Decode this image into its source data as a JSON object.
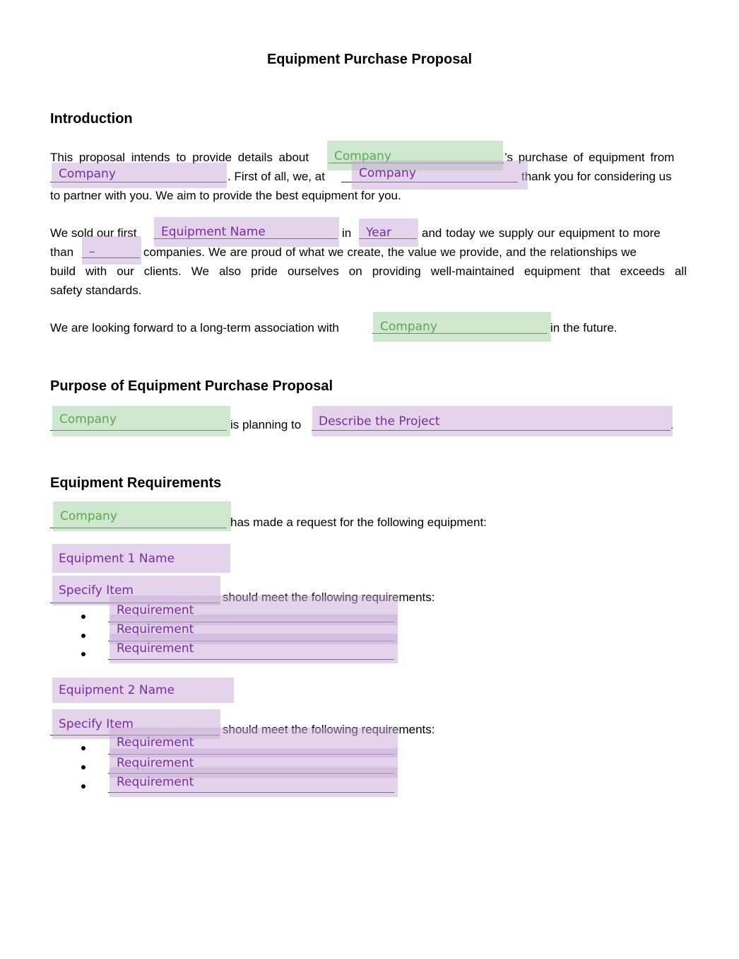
{
  "document": {
    "title": "Equipment Purchase Proposal",
    "sections": {
      "introduction": {
        "heading": "Introduction",
        "p1": {
          "line1_a": "This proposal intends to provide details about",
          "line1_b": "’s purchase of equipment from",
          "line2_a": ". First of all, we, at",
          "line2_b": "thank you for considering us",
          "line3": "to partner with you. We aim to provide the best equipment for you."
        },
        "p2": {
          "line1_a": "We sold our first",
          "line1_b": "in",
          "line1_c": "and today we supply our equipment to more",
          "line2_a": "than",
          "line2_b": "companies. We are proud of what we create, the value we provide, and the relationships we",
          "line3": "build with our clients. We also pride ourselves on providing well-maintained equipment that exceeds all",
          "line4": "safety standards."
        },
        "p3": {
          "a": "We are looking forward to a long-term association with",
          "b": "in the future."
        }
      },
      "purpose": {
        "heading": "Purpose of Equipment Purchase Proposal",
        "a": "is planning to",
        "b": "."
      },
      "requirements": {
        "heading": "Equipment Requirements",
        "intro": "has made a request for the following equipment:",
        "item_text": "should meet the following requirements:"
      }
    }
  },
  "fields": {
    "company_1": "Company",
    "company_2": "Company",
    "company_3": "Company",
    "equipment_name": "Equipment Name",
    "year": "Year",
    "count": "–",
    "company_4": "Company",
    "company_5": "Company",
    "describe_project": "Describe the Project",
    "company_6": "Company",
    "equipment_1_name": "Equipment 1 Name",
    "specify_item_1": "Specify Item",
    "equipment_1_requirements": [
      "Requirement",
      "Requirement",
      "Requirement"
    ],
    "equipment_2_name": "Equipment 2 Name",
    "specify_item_2": "Specify Item",
    "equipment_2_requirements": [
      "Requirement",
      "Requirement",
      "Requirement"
    ]
  },
  "colors": {
    "green_field_bg": "#cfe5cf",
    "green_field_text": "#5aa84f",
    "purple_field_bg": "#e3d3ea",
    "purple_field_text": "#7b2a9e"
  }
}
